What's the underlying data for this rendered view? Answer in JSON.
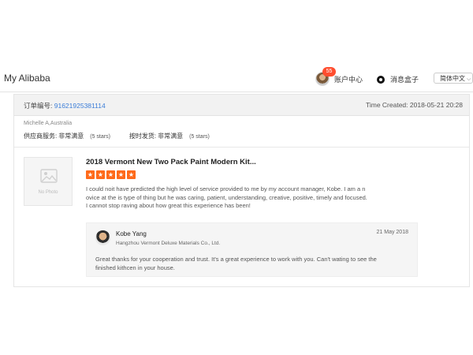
{
  "header": {
    "brand": "My Alibaba",
    "account_label": "账户中心",
    "notification_count": "55",
    "messages_label": "消息盒子",
    "language": "简体中文"
  },
  "order": {
    "label": "订单编号:",
    "number": "91621925381114",
    "time_created": "Time Created: 2018-05-21 20:28"
  },
  "reviewer": {
    "name_location": "Michelle A,Australia",
    "supplier_service_label": "供应商服务:",
    "supplier_service_value": "非常满意",
    "supplier_service_stars": "(5 stars)",
    "shipping_label": "按时发货:",
    "shipping_value": "非常满意",
    "shipping_stars": "(5 stars)"
  },
  "product": {
    "no_photo": "No Photo",
    "title": "2018 Vermont New Two Pack Paint Modern Kit...",
    "rating": 5,
    "star_color": "#ff6a1a",
    "review_lines": [
      "I could noit have predicted the high level of service provided to me by my account manager, Kobe.  I am a n",
      "ovice at the is type of thing but he was caring, patient, understanding, creative, positive, timely and focused.",
      "I cannot stop raving about how great this experience has been!"
    ]
  },
  "reply": {
    "name": "Kobe Yang",
    "company": "Hangzhou Vermont Deluxe Materials Co., Ltd.",
    "date": "21 May 2018",
    "text_lines": [
      "Great thanks for your cooperation and trust. It's a great experience to work with you. Can't wating to see the",
      "finished kithcen in your house."
    ]
  },
  "colors": {
    "link": "#3b7dd8",
    "badge": "#ff4d2e"
  }
}
